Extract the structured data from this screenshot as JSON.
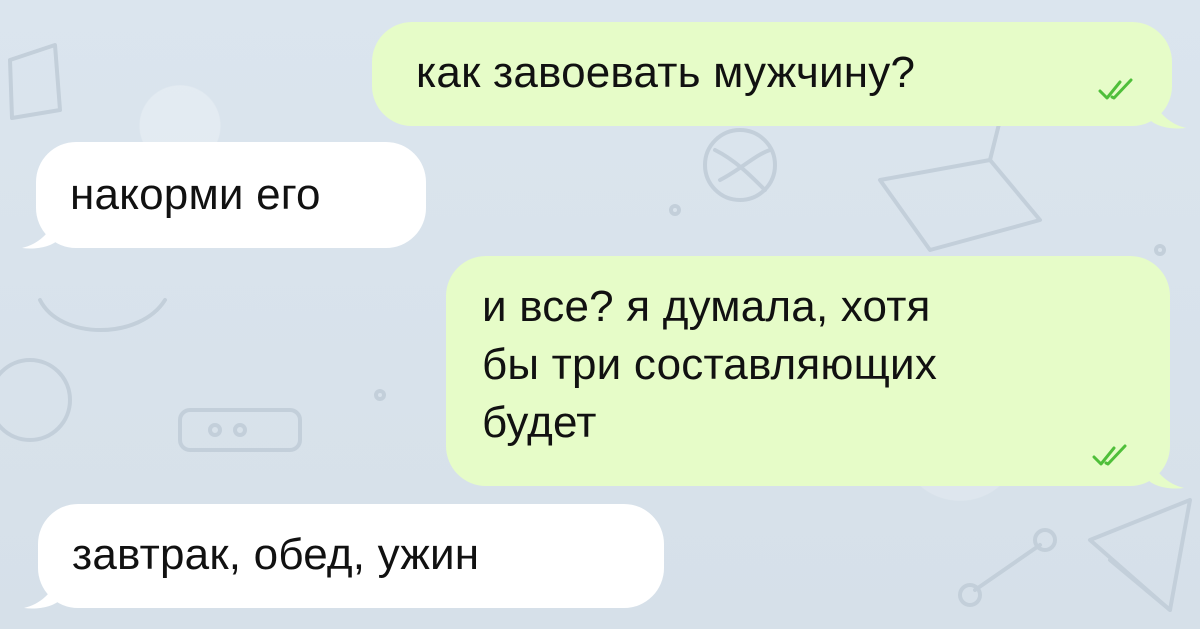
{
  "chat": {
    "messages": [
      {
        "side": "out",
        "text": "как завоевать мужчину?",
        "status": "read",
        "status_icon": "double-check-icon"
      },
      {
        "side": "in",
        "text": "накорми его"
      },
      {
        "side": "out",
        "text": "и все? я думала, хотя\nбы три составляющих\nбудет",
        "status": "read",
        "status_icon": "double-check-icon"
      },
      {
        "side": "in",
        "text": "завтрак, обед, ужин"
      }
    ]
  },
  "colors": {
    "background": "#d9e3ec",
    "outgoing_bubble": "#e6fcc8",
    "incoming_bubble": "#ffffff",
    "read_ticks": "#4fbf3a",
    "text": "#111111"
  }
}
